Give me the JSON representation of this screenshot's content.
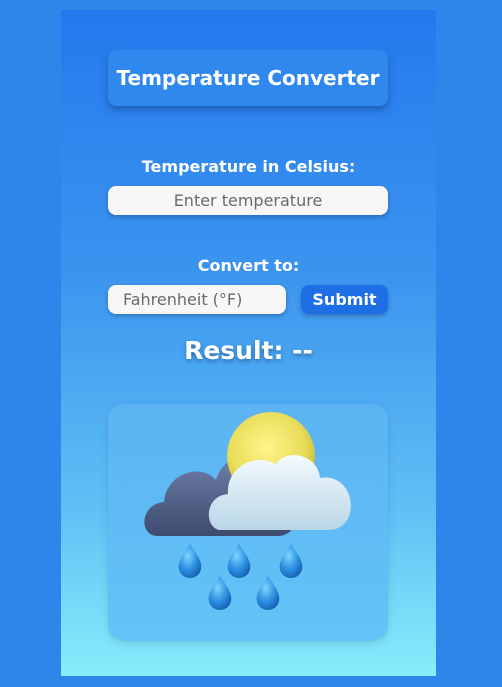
{
  "app": {
    "title": "Temperature Converter"
  },
  "form": {
    "celsius_label": "Temperature in Celsius:",
    "temperature_placeholder": "Enter temperature",
    "convert_label": "Convert to:",
    "unit_selected": "Fahrenheit (°F)",
    "submit_label": "Submit"
  },
  "result": {
    "text": "Result: --"
  },
  "weather": {
    "icon": "rain-cloud-sun-icon"
  },
  "colors": {
    "submit_button": "#1e6fe6",
    "title_box": "#2f88ee"
  }
}
